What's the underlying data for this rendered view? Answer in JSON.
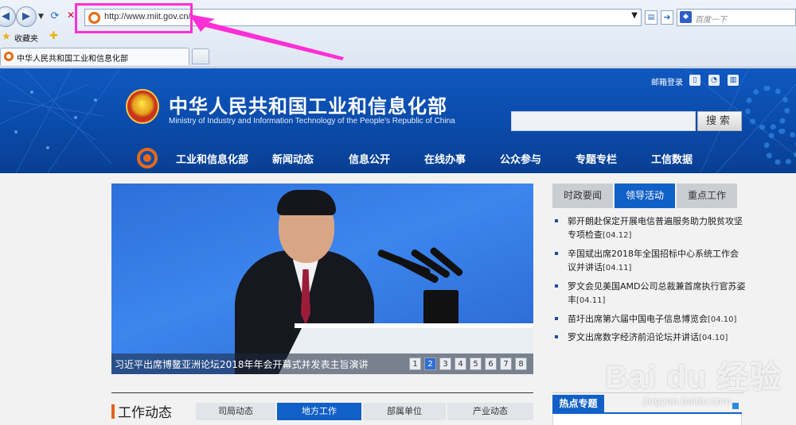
{
  "browser": {
    "url": "http://www.miit.gov.cn/",
    "search_placeholder": "百度一下",
    "search_engine_icon": "paw-icon",
    "favorites_label": "收藏夹",
    "tab_title": "中华人民共和国工业和信息化部",
    "annotation_color": "#ff2fd6"
  },
  "site": {
    "title": "中华人民共和国工业和信息化部",
    "subtitle": "Ministry of Industry and Information Technology of the People's Republic of China",
    "mail_login": "邮箱登录",
    "search_button": "搜索",
    "brand_color": "#0a4aa9",
    "nav": [
      "工业和信息化部",
      "新闻动态",
      "信息公开",
      "在线办事",
      "公众参与",
      "专题专栏",
      "工信数据"
    ]
  },
  "banner": {
    "caption": "习近平出席博鳌亚洲论坛2018年年会开幕式并发表主旨演讲",
    "pages": [
      "1",
      "2",
      "3",
      "4",
      "5",
      "6",
      "7",
      "8"
    ],
    "active_page": "2"
  },
  "news": {
    "tabs": [
      "时政要闻",
      "领导活动",
      "重点工作"
    ],
    "active_tab": "领导活动",
    "items": [
      {
        "text": "郭开朗赴保定开展电信普遍服务助力脱贫攻坚专项检查",
        "date": "[04.12]"
      },
      {
        "text": "辛国斌出席2018年全国招标中心系统工作会议并讲话",
        "date": "[04.11]"
      },
      {
        "text": "罗文会见美国AMD公司总裁兼首席执行官苏姿丰",
        "date": "[04.11]"
      },
      {
        "text": "苗圩出席第六届中国电子信息博览会",
        "date": "[04.10]"
      },
      {
        "text": "罗文出席数字经济前沿论坛并讲话",
        "date": "[04.10]"
      }
    ]
  },
  "work": {
    "title": "工作动态",
    "tabs": [
      "司局动态",
      "地方工作",
      "部属单位",
      "产业动态"
    ],
    "active_tab": "地方工作"
  },
  "hot": {
    "title": "热点专题"
  },
  "watermark": {
    "logo_text": "Bai du 经验",
    "url": "jingyan.baidu.com"
  }
}
